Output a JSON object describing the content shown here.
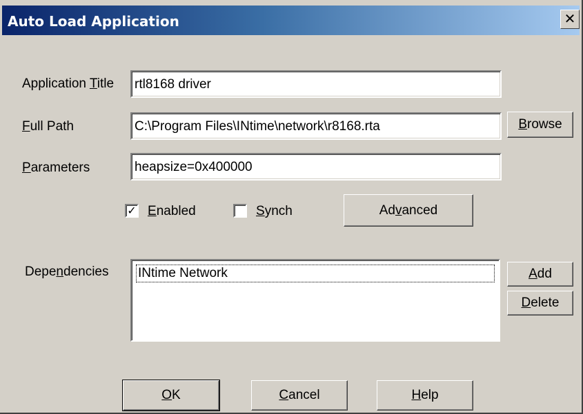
{
  "window": {
    "title": "Auto Load Application",
    "close_glyph": "✕"
  },
  "fields": {
    "app_title_label": "Application Title",
    "app_title_value": "rtl8168 driver",
    "full_path_label": "Full Path",
    "full_path_value": "C:\\Program Files\\INtime\\network\\r8168.rta",
    "parameters_label": "Parameters",
    "parameters_value": "heapsize=0x400000"
  },
  "buttons": {
    "browse": "Browse",
    "advanced": "Advanced",
    "add": "Add",
    "delete": "Delete",
    "ok": "OK",
    "cancel": "Cancel",
    "help": "Help"
  },
  "checkboxes": {
    "enabled": {
      "label": "Enabled",
      "checked": true
    },
    "synch": {
      "label": "Synch",
      "checked": false
    }
  },
  "dependencies": {
    "label": "Dependencies",
    "items": [
      "INtime Network"
    ]
  },
  "colors": {
    "dialog_bg": "#d4d0c8",
    "titlebar_start": "#0a246a",
    "titlebar_end": "#a6caf0"
  }
}
